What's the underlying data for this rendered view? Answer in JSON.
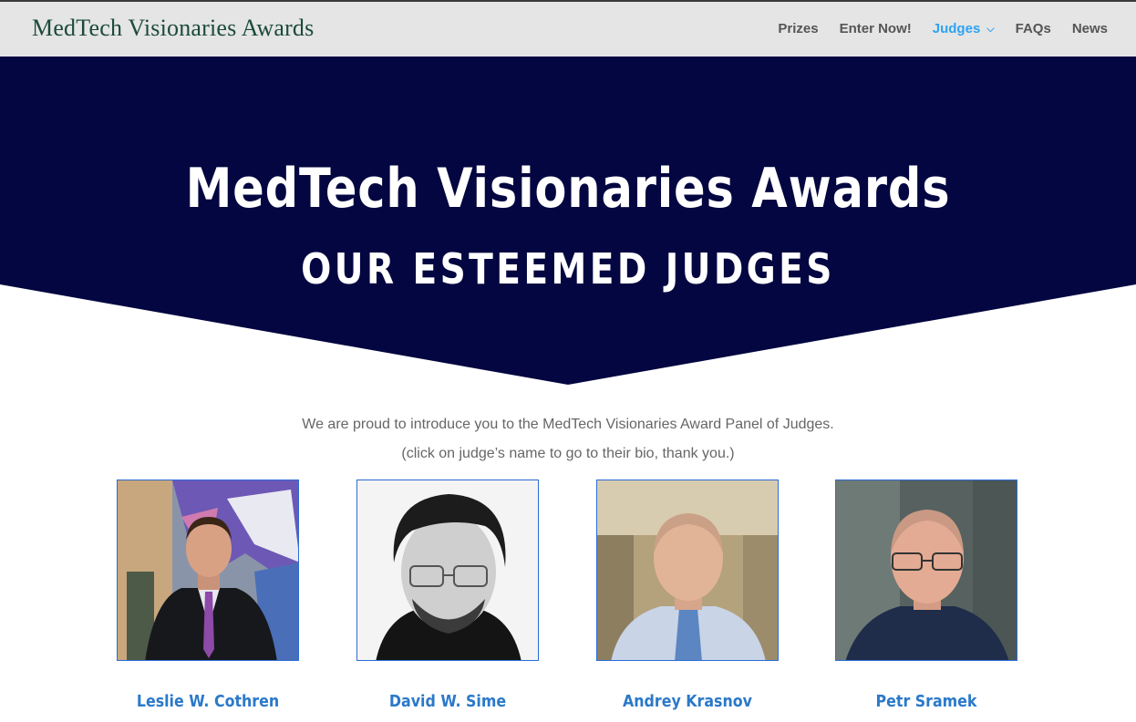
{
  "header": {
    "logo": "MedTech Visionaries Awards",
    "nav": [
      {
        "label": "Prizes"
      },
      {
        "label": "Enter Now!"
      },
      {
        "label": "Judges",
        "active": true
      },
      {
        "label": "FAQs"
      },
      {
        "label": "News"
      }
    ],
    "dropdown_icon": "chevron-down-icon"
  },
  "hero": {
    "title": "MedTech Visionaries Awards",
    "subtitle": "OUR ESTEEMED JUDGES",
    "background_color": "#030640"
  },
  "intro": {
    "line1": "We are proud to introduce you to the MedTech Visionaries Award Panel of Judges.",
    "line2": "(click on judge’s name to go to their bio, thank you.)"
  },
  "judges": [
    {
      "name": "Leslie W. Cothren"
    },
    {
      "name": "David W. Sime"
    },
    {
      "name": "Andrey Krasnov"
    },
    {
      "name": "Petr Sramek"
    }
  ],
  "colors": {
    "accent": "#2ea3f2",
    "name_link": "#2b79c9",
    "hero_bg": "#030640",
    "header_bg": "#e5e5e5"
  }
}
